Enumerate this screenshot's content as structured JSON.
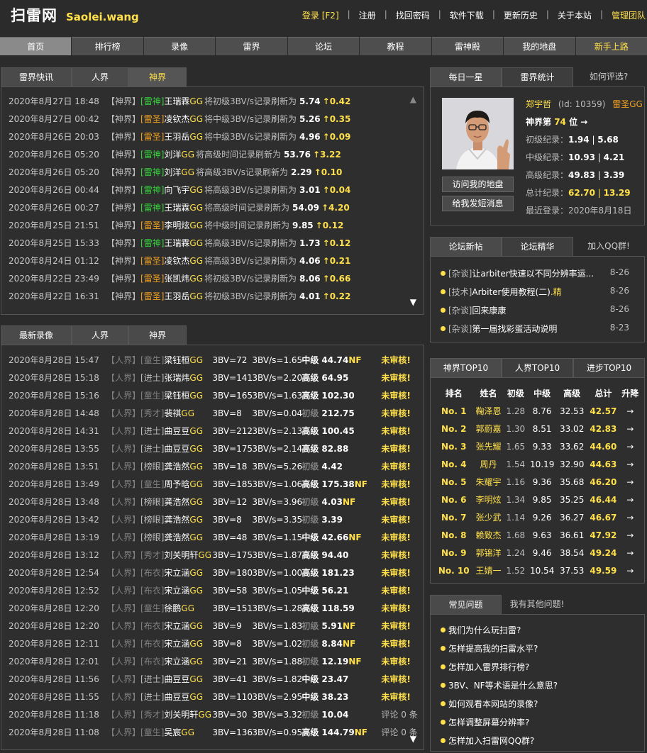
{
  "header": {
    "logo": "扫雷网",
    "logo_sub": "Saolei.wang",
    "links": [
      "登录 [F2]",
      "注册",
      "找回密码",
      "软件下载",
      "更新历史",
      "关于本站",
      "管理团队"
    ]
  },
  "mainnav": [
    "首页",
    "排行榜",
    "录像",
    "雷界",
    "论坛",
    "教程",
    "雷神殿",
    "我的地盘",
    "新手上路"
  ],
  "news": {
    "tabs": [
      "雷界快讯",
      "人界",
      "神界"
    ],
    "items": [
      {
        "time": "2020年8月27日 18:48",
        "world": "【神界】",
        "rank": "[雷神]",
        "name": "王瑞霖",
        "gg": "GG",
        "text": "将初级3BV/s记录刷新为",
        "value": "5.74",
        "delta": "↑0.42"
      },
      {
        "time": "2020年8月27日 00:42",
        "world": "【神界】",
        "rank": "[雷圣]",
        "name": "凌钦杰",
        "gg": "GG",
        "text": "将中级3BV/s记录刷新为",
        "value": "5.26",
        "delta": "↑0.35"
      },
      {
        "time": "2020年8月26日 20:03",
        "world": "【神界】",
        "rank": "[雷圣]",
        "name": "王羽岳",
        "gg": "GG",
        "text": "将中级3BV/s记录刷新为",
        "value": "4.96",
        "delta": "↑0.09"
      },
      {
        "time": "2020年8月26日 05:20",
        "world": "【神界】",
        "rank": "[雷神]",
        "name": "刘洋",
        "gg": "GG",
        "text": "将高级时间记录刷新为",
        "value": "53.76",
        "delta": "↑3.22"
      },
      {
        "time": "2020年8月26日 05:20",
        "world": "【神界】",
        "rank": "[雷神]",
        "name": "刘洋",
        "gg": "GG",
        "text": "将高级3BV/s记录刷新为",
        "value": "2.29",
        "delta": "↑0.10"
      },
      {
        "time": "2020年8月26日 00:44",
        "world": "【神界】",
        "rank": "[雷神]",
        "name": "向飞宇",
        "gg": "GG",
        "text": "将高级3BV/s记录刷新为",
        "value": "3.01",
        "delta": "↑0.04"
      },
      {
        "time": "2020年8月26日 00:27",
        "world": "【神界】",
        "rank": "[雷神]",
        "name": "王瑞霖",
        "gg": "GG",
        "text": "将高级时间记录刷新为",
        "value": "54.09",
        "delta": "↑4.20"
      },
      {
        "time": "2020年8月25日 21:51",
        "world": "【神界】",
        "rank": "[雷圣]",
        "name": "李明炫",
        "gg": "GG",
        "text": "将中级时间记录刷新为",
        "value": "9.85",
        "delta": "↑0.12"
      },
      {
        "time": "2020年8月25日 15:33",
        "world": "【神界】",
        "rank": "[雷神]",
        "name": "王瑞霖",
        "gg": "GG",
        "text": "将高级3BV/s记录刷新为",
        "value": "1.73",
        "delta": "↑0.12"
      },
      {
        "time": "2020年8月24日 01:12",
        "world": "【神界】",
        "rank": "[雷圣]",
        "name": "凌钦杰",
        "gg": "GG",
        "text": "将高级3BV/s记录刷新为",
        "value": "4.06",
        "delta": "↑0.21"
      },
      {
        "time": "2020年8月22日 23:49",
        "world": "【神界】",
        "rank": "[雷圣]",
        "name": "张凯炜",
        "gg": "GG",
        "text": "将初级3BV/s记录刷新为",
        "value": "8.06",
        "delta": "↑0.66"
      },
      {
        "time": "2020年8月22日 16:31",
        "world": "【神界】",
        "rank": "[雷圣]",
        "name": "王羽岳",
        "gg": "GG",
        "text": "将初级3BV/s记录刷新为",
        "value": "4.01",
        "delta": "↑0.22"
      }
    ]
  },
  "videos": {
    "tabs": [
      "最新录像",
      "人界",
      "神界"
    ],
    "items": [
      {
        "time": "2020年8月28日 15:47",
        "world": "【人界】",
        "rank": "[童生]",
        "name": "梁钰桓",
        "gg": "GG",
        "bbv": "3BV=72",
        "bbvs": "3BV/s=1.65",
        "level": "中级",
        "t": "44.74",
        "nf": "NF",
        "status": "未审核!"
      },
      {
        "time": "2020年8月28日 15:18",
        "world": "【人界】",
        "rank": "[进士]",
        "name": "张瑞炜",
        "gg": "GG",
        "bbv": "3BV=141",
        "bbvs": "3BV/s=2.20",
        "level": "高级",
        "t": "64.95",
        "nf": "",
        "status": "未审核!"
      },
      {
        "time": "2020年8月28日 15:16",
        "world": "【人界】",
        "rank": "[童生]",
        "name": "梁钰桓",
        "gg": "GG",
        "bbv": "3BV=165",
        "bbvs": "3BV/s=1.63",
        "level": "高级",
        "t": "102.30",
        "nf": "",
        "status": "未审核!"
      },
      {
        "time": "2020年8月28日 14:48",
        "world": "【人界】",
        "rank": "[秀才]",
        "name": "裴祺",
        "gg": "GG",
        "bbv": "3BV=8",
        "bbvs": "3BV/s=0.04",
        "level": "初级",
        "t": "212.75",
        "nf": "",
        "status": "未审核!"
      },
      {
        "time": "2020年8月28日 14:31",
        "world": "【人界】",
        "rank": "[进士]",
        "name": "曲豆豆",
        "gg": "GG",
        "bbv": "3BV=212",
        "bbvs": "3BV/s=2.13",
        "level": "高级",
        "t": "100.45",
        "nf": "",
        "status": "未审核!"
      },
      {
        "time": "2020年8月28日 13:55",
        "world": "【人界】",
        "rank": "[进士]",
        "name": "曲豆豆",
        "gg": "GG",
        "bbv": "3BV=175",
        "bbvs": "3BV/s=2.14",
        "level": "高级",
        "t": "82.88",
        "nf": "",
        "status": "未审核!"
      },
      {
        "time": "2020年8月28日 13:51",
        "world": "【人界】",
        "rank": "[榜眼]",
        "name": "龚浩然",
        "gg": "GG",
        "bbv": "3BV=18",
        "bbvs": "3BV/s=5.26",
        "level": "初级",
        "t": "4.42",
        "nf": "",
        "status": "未审核!"
      },
      {
        "time": "2020年8月28日 13:49",
        "world": "【人界】",
        "rank": "[童生]",
        "name": "周予晗",
        "gg": "GG",
        "bbv": "3BV=185",
        "bbvs": "3BV/s=1.06",
        "level": "高级",
        "t": "175.38",
        "nf": "NF",
        "status": "未审核!"
      },
      {
        "time": "2020年8月28日 13:48",
        "world": "【人界】",
        "rank": "[榜眼]",
        "name": "龚浩然",
        "gg": "GG",
        "bbv": "3BV=12",
        "bbvs": "3BV/s=3.96",
        "level": "初级",
        "t": "4.03",
        "nf": "NF",
        "status": "未审核!"
      },
      {
        "time": "2020年8月28日 13:42",
        "world": "【人界】",
        "rank": "[榜眼]",
        "name": "龚浩然",
        "gg": "GG",
        "bbv": "3BV=8",
        "bbvs": "3BV/s=3.35",
        "level": "初级",
        "t": "3.39",
        "nf": "",
        "status": "未审核!"
      },
      {
        "time": "2020年8月28日 13:19",
        "world": "【人界】",
        "rank": "[榜眼]",
        "name": "龚浩然",
        "gg": "GG",
        "bbv": "3BV=48",
        "bbvs": "3BV/s=1.15",
        "level": "中级",
        "t": "42.66",
        "nf": "NF",
        "status": "未审核!"
      },
      {
        "time": "2020年8月28日 13:12",
        "world": "【人界】",
        "rank": "[秀才]",
        "name": "刘关明轩",
        "gg": "GG",
        "bbv": "3BV=175",
        "bbvs": "3BV/s=1.87",
        "level": "高级",
        "t": "94.40",
        "nf": "",
        "status": "未审核!"
      },
      {
        "time": "2020年8月28日 12:54",
        "world": "【人界】",
        "rank": "[布衣]",
        "name": "宋立涵",
        "gg": "GG",
        "bbv": "3BV=180",
        "bbvs": "3BV/s=1.00",
        "level": "高级",
        "t": "181.23",
        "nf": "",
        "status": "未审核!"
      },
      {
        "time": "2020年8月28日 12:52",
        "world": "【人界】",
        "rank": "[布衣]",
        "name": "宋立涵",
        "gg": "GG",
        "bbv": "3BV=58",
        "bbvs": "3BV/s=1.05",
        "level": "中级",
        "t": "56.21",
        "nf": "",
        "status": "未审核!"
      },
      {
        "time": "2020年8月28日 12:20",
        "world": "【人界】",
        "rank": "[童生]",
        "name": "徐鹏",
        "gg": "GG",
        "bbv": "3BV=151",
        "bbvs": "3BV/s=1.28",
        "level": "高级",
        "t": "118.59",
        "nf": "",
        "status": "未审核!"
      },
      {
        "time": "2020年8月28日 12:20",
        "world": "【人界】",
        "rank": "[布衣]",
        "name": "宋立涵",
        "gg": "GG",
        "bbv": "3BV=9",
        "bbvs": "3BV/s=1.83",
        "level": "初级",
        "t": "5.91",
        "nf": "NF",
        "status": "未审核!"
      },
      {
        "time": "2020年8月28日 12:11",
        "world": "【人界】",
        "rank": "[布衣]",
        "name": "宋立涵",
        "gg": "GG",
        "bbv": "3BV=8",
        "bbvs": "3BV/s=1.02",
        "level": "初级",
        "t": "8.84",
        "nf": "NF",
        "status": "未审核!"
      },
      {
        "time": "2020年8月28日 12:01",
        "world": "【人界】",
        "rank": "[布衣]",
        "name": "宋立涵",
        "gg": "GG",
        "bbv": "3BV=21",
        "bbvs": "3BV/s=1.88",
        "level": "初级",
        "t": "12.19",
        "nf": "NF",
        "status": "未审核!"
      },
      {
        "time": "2020年8月28日 11:56",
        "world": "【人界】",
        "rank": "[进士]",
        "name": "曲豆豆",
        "gg": "GG",
        "bbv": "3BV=41",
        "bbvs": "3BV/s=1.82",
        "level": "中级",
        "t": "23.47",
        "nf": "",
        "status": "未审核!"
      },
      {
        "time": "2020年8月28日 11:55",
        "world": "【人界】",
        "rank": "[进士]",
        "name": "曲豆豆",
        "gg": "GG",
        "bbv": "3BV=110",
        "bbvs": "3BV/s=2.95",
        "level": "中级",
        "t": "38.23",
        "nf": "",
        "status": "未审核!"
      },
      {
        "time": "2020年8月28日 11:18",
        "world": "【人界】",
        "rank": "[秀才]",
        "name": "刘关明轩",
        "gg": "GG",
        "bbv": "3BV=30",
        "bbvs": "3BV/s=3.32",
        "level": "初级",
        "t": "10.04",
        "nf": "",
        "status": "评论 0 条"
      },
      {
        "time": "2020年8月28日 11:08",
        "world": "【人界】",
        "rank": "[童生]",
        "name": "吴宸",
        "gg": "GG",
        "bbv": "3BV=136",
        "bbvs": "3BV/s=0.95",
        "level": "高级",
        "t": "144.79",
        "nf": "NF",
        "status": "评论 0 条"
      }
    ]
  },
  "star": {
    "tabs": [
      "每日一星",
      "雷界统计",
      "如何评选?"
    ],
    "name": "郑宇哲",
    "id": "(Id: 10359)",
    "title": "雷圣GG",
    "rank_prefix": "神界第",
    "rank_num": "74",
    "rank_suffix": "位 →",
    "btn_visit": "访问我的地盘",
    "btn_msg": "给我发短消息",
    "stats": [
      {
        "label": "初级纪录：",
        "a": "1.94",
        "sep": " | ",
        "b": "5.68"
      },
      {
        "label": "中级纪录：",
        "a": "10.93",
        "sep": " | ",
        "b": "4.21"
      },
      {
        "label": "高级纪录：",
        "a": "49.83",
        "sep": " | ",
        "b": "3.39"
      },
      {
        "label": "总计纪录：",
        "a": "62.70",
        "sep": " | ",
        "b": "13.29"
      }
    ],
    "last_login": "最近登录：2020年8月18日"
  },
  "forum": {
    "tabs": [
      "论坛新帖",
      "论坛精华",
      "加入QQ群!"
    ],
    "items": [
      {
        "tag": "[杂谈]",
        "title": "让arbiter快速以不同分辨率运...",
        "date": "8-26"
      },
      {
        "tag": "[技术]",
        "title": "Arbiter使用教程(二)",
        "suffix": ".精",
        "date": "8-26"
      },
      {
        "tag": "[杂谈]",
        "title": "回来康康",
        "date": "8-26"
      },
      {
        "tag": "[杂谈]",
        "title": "第一届找彩蛋活动说明",
        "date": "8-23"
      }
    ]
  },
  "top10": {
    "tabs": [
      "神界TOP10",
      "人界TOP10",
      "进步TOP10"
    ],
    "headers": [
      "排名",
      "姓名",
      "初级",
      "中级",
      "高级",
      "总计",
      "升降"
    ],
    "rows": [
      {
        "no": "No. 1",
        "name": "鞠泽恩",
        "b": "1.28",
        "i": "8.76",
        "e": "32.53",
        "t": "42.57",
        "arrow": "→"
      },
      {
        "no": "No. 2",
        "name": "郭蔚嘉",
        "b": "1.30",
        "i": "8.51",
        "e": "33.02",
        "t": "42.83",
        "arrow": "→"
      },
      {
        "no": "No. 3",
        "name": "张先耀",
        "b": "1.65",
        "i": "9.33",
        "e": "33.62",
        "t": "44.60",
        "arrow": "→"
      },
      {
        "no": "No. 4",
        "name": "周丹",
        "b": "1.54",
        "i": "10.19",
        "e": "32.90",
        "t": "44.63",
        "arrow": "→"
      },
      {
        "no": "No. 5",
        "name": "朱耀宇",
        "b": "1.16",
        "i": "9.36",
        "e": "35.68",
        "t": "46.20",
        "arrow": "→"
      },
      {
        "no": "No. 6",
        "name": "李明炫",
        "b": "1.34",
        "i": "9.85",
        "e": "35.25",
        "t": "46.44",
        "arrow": "→"
      },
      {
        "no": "No. 7",
        "name": "张少武",
        "b": "1.14",
        "i": "9.26",
        "e": "36.27",
        "t": "46.67",
        "arrow": "→"
      },
      {
        "no": "No. 8",
        "name": "赖致杰",
        "b": "1.68",
        "i": "9.63",
        "e": "36.61",
        "t": "47.92",
        "arrow": "→"
      },
      {
        "no": "No. 9",
        "name": "郭锦洋",
        "b": "1.24",
        "i": "9.46",
        "e": "38.54",
        "t": "49.24",
        "arrow": "→"
      },
      {
        "no": "No. 10",
        "name": "王婧一",
        "b": "1.52",
        "i": "10.54",
        "e": "37.53",
        "t": "49.59",
        "arrow": "→"
      }
    ]
  },
  "faq": {
    "tabs": [
      "常见问题",
      "我有其他问题!"
    ],
    "items": [
      "我们为什么玩扫雷?",
      "怎样提高我的扫雷水平?",
      "怎样加入雷界排行榜?",
      "3BV、NF等术语是什么意思?",
      "如何观看本网站的录像?",
      "怎样调整屏幕分辨率?",
      "怎样加入扫雷网QQ群?"
    ]
  },
  "colors": {
    "accent": "#ffe04a",
    "green_rank": "#35d43c",
    "orange_rank": "#f0a020",
    "bg": "#2b2b2b"
  }
}
